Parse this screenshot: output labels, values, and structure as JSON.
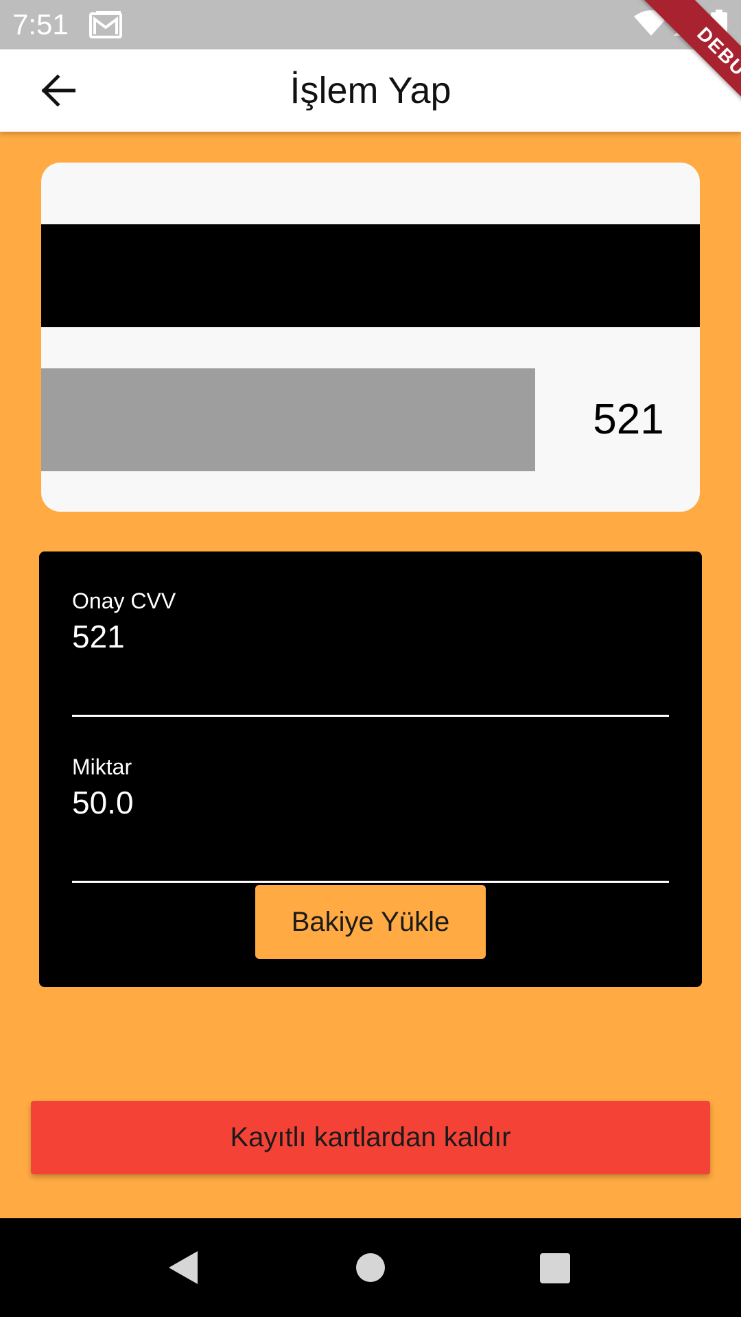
{
  "status_bar": {
    "time": "7:51",
    "icons": [
      "mail-icon",
      "wifi-icon",
      "signal-icon",
      "battery-icon"
    ]
  },
  "debug_banner": "DEBUG",
  "app_bar": {
    "title": "İşlem Yap",
    "back_icon": "arrow-back-icon"
  },
  "card": {
    "cvv": "521"
  },
  "form": {
    "cvv_field": {
      "label": "Onay CVV",
      "value": "521"
    },
    "amount_field": {
      "label": "Miktar",
      "value": "50.0"
    },
    "submit_label": "Bakiye Yükle"
  },
  "remove_button_label": "Kayıtlı kartlardan kaldır",
  "nav_bar": {
    "icons": [
      "nav-back-icon",
      "nav-home-icon",
      "nav-recents-icon"
    ]
  },
  "colors": {
    "background": "#FFAA42",
    "accent": "#FFAA42",
    "danger": "#F44336",
    "status_bar": "#BDBDBD",
    "debug_ribbon": "#A8232F"
  }
}
